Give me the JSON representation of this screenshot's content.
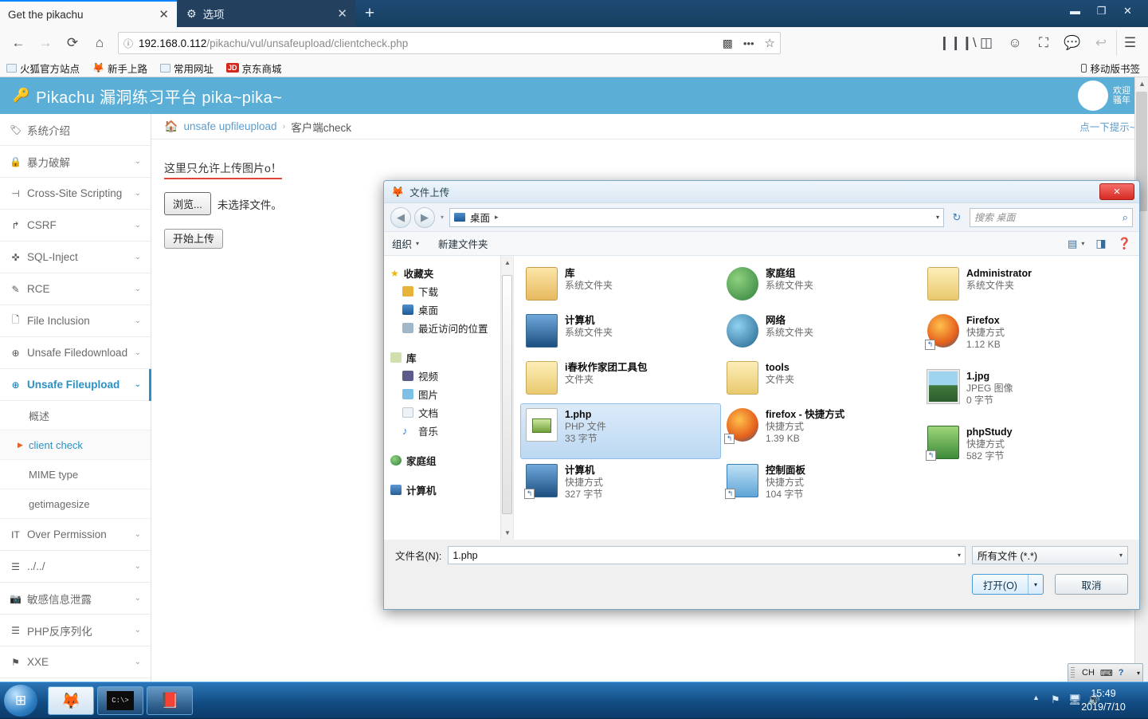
{
  "browser": {
    "tabs": [
      {
        "title": "Get the pikachu",
        "active": true,
        "close": "✕"
      },
      {
        "title": "选项",
        "active": false,
        "close": "✕",
        "icon": "gear-icon"
      }
    ],
    "new_tab": "+",
    "window_controls": {
      "minimize": "▬",
      "maximize": "❐",
      "close": "✕"
    },
    "nav": {
      "back": "←",
      "forward": "→",
      "reload": "⟳",
      "home": "⌂"
    },
    "url": {
      "scheme_icon": "ⓘ",
      "host": "192.168.0.112",
      "path": "/pikachu/vul/unsafeupload/clientcheck.php",
      "qr_icon": "▩",
      "more_icon": "•••",
      "bookmark_icon": "☆"
    },
    "right_icons": [
      "library-icon",
      "sidebar-icon",
      "account-icon",
      "screenshot-icon",
      "pocket-icon",
      "undo-icon",
      "menu-icon"
    ],
    "bookmarks": [
      {
        "label": "火狐官方站点",
        "icon": "folder-icon"
      },
      {
        "label": "新手上路",
        "icon": "firefox-icon"
      },
      {
        "label": "常用网址",
        "icon": "folder-icon"
      },
      {
        "label": "京东商城",
        "icon": "jd-icon",
        "badge": "JD"
      }
    ],
    "mobile_bookmarks": "移动版书签"
  },
  "pikachu": {
    "title": "Pikachu 漏洞练习平台 pika~pika~",
    "title_icon": "key-icon",
    "avatar_icon": "pikachu-icon",
    "welcome_line1": "欢迎",
    "welcome_line2": "骚年",
    "breadcrumb": {
      "home_icon": "home-icon",
      "link": "unsafe upfileupload",
      "sep": "›",
      "current": "客户端check",
      "hint": "点一下提示~"
    },
    "notice": "这里只允许上传图片o！",
    "browse_button": "浏览...",
    "no_file_text": "未选择文件。",
    "start_upload_button": "开始上传",
    "sidebar": [
      {
        "label": "系统介绍",
        "icon": "tag-icon",
        "chevron": "",
        "active": false
      },
      {
        "label": "暴力破解",
        "icon": "lock-icon",
        "chevron": "⌄",
        "active": false
      },
      {
        "label": "Cross-Site Scripting",
        "icon": "xss-icon",
        "chevron": "⌄",
        "active": false
      },
      {
        "label": "CSRF",
        "icon": "external-icon",
        "chevron": "⌄",
        "active": false
      },
      {
        "label": "SQL-Inject",
        "icon": "inject-icon",
        "chevron": "⌄",
        "active": false
      },
      {
        "label": "RCE",
        "icon": "pen-icon",
        "chevron": "⌄",
        "active": false
      },
      {
        "label": "File Inclusion",
        "icon": "file-icon",
        "chevron": "⌄",
        "active": false
      },
      {
        "label": "Unsafe Filedownload",
        "icon": "download-icon",
        "chevron": "⌄",
        "active": false
      },
      {
        "label": "Unsafe Fileupload",
        "icon": "upload-icon",
        "chevron": "⌄",
        "active": true
      }
    ],
    "sidebar_sub": [
      {
        "label": "概述",
        "current": false
      },
      {
        "label": "client check",
        "current": true
      },
      {
        "label": "MIME type",
        "current": false
      },
      {
        "label": "getimagesize",
        "current": false
      }
    ],
    "sidebar_tail": [
      {
        "label": "Over Permission",
        "icon": "it-icon",
        "chevron": "⌄"
      },
      {
        "label": "../../",
        "icon": "list-icon",
        "chevron": "⌄"
      },
      {
        "label": "敏感信息泄露",
        "icon": "camera-icon",
        "chevron": "⌄"
      },
      {
        "label": "PHP反序列化",
        "icon": "list-icon",
        "chevron": "⌄"
      },
      {
        "label": "XXE",
        "icon": "flag-icon",
        "chevron": "⌄"
      }
    ]
  },
  "dialog": {
    "title": "文件上传",
    "title_icon": "firefox-icon",
    "close_label": "✕",
    "back_icon": "◀",
    "forward_icon": "▶",
    "history_caret": "▾",
    "address": {
      "icon": "desktop-icon",
      "path": "桌面",
      "arrow": "▸",
      "dropdown": "▾"
    },
    "refresh_icon": "↻",
    "search_placeholder": "搜索 桌面",
    "search_icon": "⌕",
    "toolbar": {
      "organize": "组织",
      "organize_caret": "▾",
      "new_folder": "新建文件夹",
      "view_icon": "view-icon",
      "view_caret": "▾",
      "preview_icon": "preview-pane-icon",
      "help_icon": "help-icon"
    },
    "places": [
      {
        "label": "收藏夹",
        "type": "head",
        "icon": "star-icon",
        "color": "#f7c948"
      },
      {
        "label": "下载",
        "type": "item",
        "icon": "downloads-icon",
        "color": "#e8b33a"
      },
      {
        "label": "桌面",
        "type": "item",
        "icon": "desktop-icon",
        "color": "#3d6fa5"
      },
      {
        "label": "最近访问的位置",
        "type": "item",
        "icon": "recent-icon",
        "color": "#8fa9bf"
      },
      {
        "label": "库",
        "type": "head",
        "icon": "library-icon",
        "color": "#c9dca8"
      },
      {
        "label": "视频",
        "type": "item",
        "icon": "video-icon",
        "color": "#5a5a8e"
      },
      {
        "label": "图片",
        "type": "item",
        "icon": "pictures-icon",
        "color": "#6fb2d8"
      },
      {
        "label": "文档",
        "type": "item",
        "icon": "documents-icon",
        "color": "#e3e8ee"
      },
      {
        "label": "音乐",
        "type": "item",
        "icon": "music-icon",
        "color": "#3e8fd0"
      },
      {
        "label": "家庭组",
        "type": "head",
        "icon": "homegroup-icon",
        "color": "#58b14c"
      },
      {
        "label": "计算机",
        "type": "head",
        "icon": "computer-icon",
        "color": "#4a7fb5"
      }
    ],
    "files_col1": [
      {
        "name": "库",
        "type": "系统文件夹",
        "size": "",
        "icon": "library-folder-icon",
        "selected": false
      },
      {
        "name": "计算机",
        "type": "系统文件夹",
        "size": "",
        "icon": "computer-icon",
        "selected": false
      },
      {
        "name": "i春秋作家团工具包",
        "type": "文件夹",
        "size": "",
        "icon": "folder-icon",
        "selected": false
      },
      {
        "name": "1.php",
        "type": "PHP 文件",
        "size": "33 字节",
        "icon": "php-file-icon",
        "selected": true
      },
      {
        "name": "计算机",
        "type": "快捷方式",
        "size": "327 字节",
        "icon": "computer-shortcut-icon",
        "selected": false
      }
    ],
    "files_col2": [
      {
        "name": "家庭组",
        "type": "系统文件夹",
        "size": "",
        "icon": "homegroup-icon",
        "selected": false
      },
      {
        "name": "网络",
        "type": "系统文件夹",
        "size": "",
        "icon": "network-icon",
        "selected": false
      },
      {
        "name": "tools",
        "type": "文件夹",
        "size": "",
        "icon": "folder-icon",
        "selected": false
      },
      {
        "name": "firefox - 快捷方式",
        "type": "快捷方式",
        "size": "1.39 KB",
        "icon": "firefox-shortcut-icon",
        "selected": false
      },
      {
        "name": "控制面板",
        "type": "快捷方式",
        "size": "104 字节",
        "icon": "control-panel-icon",
        "selected": false
      }
    ],
    "files_col3": [
      {
        "name": "Administrator",
        "type": "系统文件夹",
        "size": "",
        "icon": "user-folder-icon",
        "selected": false
      },
      {
        "name": "Firefox",
        "type": "快捷方式",
        "size": "1.12 KB",
        "icon": "firefox-shortcut-icon",
        "selected": false
      },
      {
        "name": "1.jpg",
        "type": "JPEG 图像",
        "size": "0 字节",
        "icon": "jpeg-thumb-icon",
        "selected": false
      },
      {
        "name": "phpStudy",
        "type": "快捷方式",
        "size": "582 字节",
        "icon": "phpstudy-shortcut-icon",
        "selected": false
      }
    ],
    "filename_label": "文件名(N):",
    "filename_value": "1.php",
    "filter_value": "所有文件 (*.*)",
    "open_button": "打开(O)",
    "open_caret": "▾",
    "cancel_button": "取消"
  },
  "taskbar": {
    "start_icon": "windows-start-icon",
    "buttons": [
      {
        "icon": "firefox-icon",
        "lit": true
      },
      {
        "icon": "cmd-icon",
        "lit": false
      },
      {
        "icon": "book-icon",
        "lit": false
      }
    ],
    "ime": {
      "lang": "CH",
      "keyboard_icon": "⌨",
      "help_icon": "?",
      "more_icon": "▾"
    },
    "tray": {
      "show_hidden": "▲",
      "network_icon": "network-icon",
      "action_icon": "flag-icon",
      "volume_icon": "🔊"
    },
    "time": "15:49",
    "date": "2019/7/10"
  }
}
